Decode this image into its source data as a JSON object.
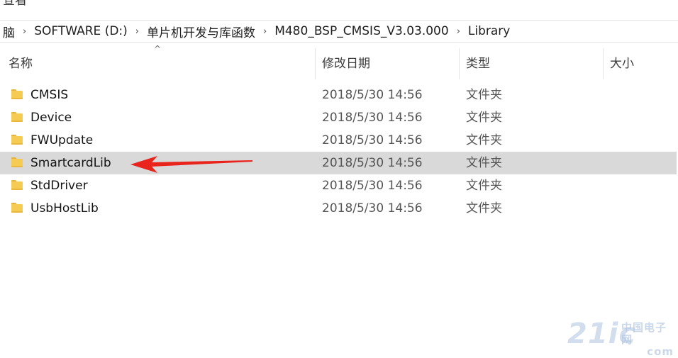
{
  "ribbon": {
    "view_tab": "查看"
  },
  "address": {
    "crumbs": [
      "脑",
      "SOFTWARE (D:)",
      "单片机开发与库函数",
      "M480_BSP_CMSIS_V3.03.000",
      "Library"
    ],
    "separator": "›"
  },
  "columns": {
    "name": "名称",
    "date": "修改日期",
    "type": "类型",
    "size": "大小",
    "sort_indicator": "^"
  },
  "files": [
    {
      "name": "CMSIS",
      "date": "2018/5/30 14:56",
      "type": "文件夹"
    },
    {
      "name": "Device",
      "date": "2018/5/30 14:56",
      "type": "文件夹"
    },
    {
      "name": "FWUpdate",
      "date": "2018/5/30 14:56",
      "type": "文件夹"
    },
    {
      "name": "SmartcardLib",
      "date": "2018/5/30 14:56",
      "type": "文件夹"
    },
    {
      "name": "StdDriver",
      "date": "2018/5/30 14:56",
      "type": "文件夹"
    },
    {
      "name": "UsbHostLib",
      "date": "2018/5/30 14:56",
      "type": "文件夹"
    }
  ],
  "selected_index": 3,
  "icons": {
    "folder": "folder-icon",
    "annotation": "red-arrow-icon"
  },
  "colors": {
    "selection": "#d9d9d9",
    "folder": "#f6cb54",
    "arrow": "#e8241c"
  },
  "watermark": {
    "main": "21ic",
    "line1": "中国电子网",
    "line2": "com"
  }
}
